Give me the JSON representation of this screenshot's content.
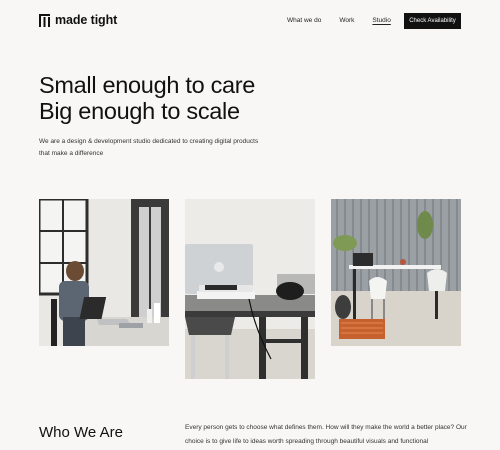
{
  "brand": {
    "name": "made tight",
    "icon": "grid-logo-icon"
  },
  "nav": {
    "items": [
      {
        "label": "What we do"
      },
      {
        "label": "Work"
      },
      {
        "label": "Studio",
        "active": true
      }
    ],
    "cta_label": "Check Availability"
  },
  "hero": {
    "line1": "Small enough to care",
    "line2": "Big enough to scale",
    "description": "We are a design & development studio dedicated to creating digital products that make a difference"
  },
  "gallery": [
    {
      "subject": "woman-working-at-desk-photo"
    },
    {
      "subject": "laptop-and-headphones-desk-photo"
    },
    {
      "subject": "patio-workspace-photo"
    }
  ],
  "about": {
    "title": "Who We Are",
    "text": "Every person gets to choose what defines them. How will they make the world a better place? Our choice is to give life to ideas worth spreading through beautiful visuals and functional"
  },
  "colors": {
    "background": "#f8f7f5",
    "text": "#111111",
    "cta_bg": "#111111",
    "cta_text": "#ffffff"
  }
}
